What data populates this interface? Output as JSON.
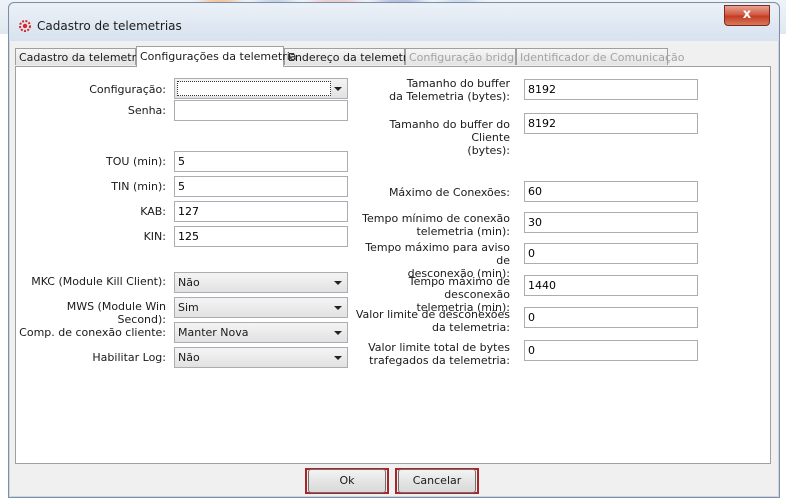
{
  "window": {
    "title": "Cadastro de telemetrias",
    "close_label": "x"
  },
  "tabs": [
    {
      "label": "Cadastro da telemetria",
      "state": "normal"
    },
    {
      "label": "Configurações da telemetria",
      "state": "active"
    },
    {
      "label": "Endereço da telemetria",
      "state": "normal"
    },
    {
      "label": "Configuração bridge",
      "state": "disabled"
    },
    {
      "label": "Identificador de Comunicação",
      "state": "disabled"
    }
  ],
  "left": {
    "configuracao": {
      "label": "Configuração:",
      "value": ""
    },
    "senha": {
      "label": "Senha:",
      "value": ""
    },
    "tou": {
      "label": "TOU (min):",
      "value": "5"
    },
    "tin": {
      "label": "TIN (min):",
      "value": "5"
    },
    "kab": {
      "label": "KAB:",
      "value": "127"
    },
    "kin": {
      "label": "KIN:",
      "value": "125"
    },
    "mkc": {
      "label": "MKC (Module Kill Client):",
      "value": "Não"
    },
    "mws": {
      "label": "MWS (Module Win Second):",
      "value": "Sim"
    },
    "comp": {
      "label": "Comp. de conexão cliente:",
      "value": "Manter Nova"
    },
    "log": {
      "label": "Habilitar Log:",
      "value": "Não"
    }
  },
  "right": {
    "buffer_tel": {
      "label_1": "Tamanho do buffer",
      "label_2": "da Telemetria (bytes):",
      "value": "8192"
    },
    "buffer_cli": {
      "label_1": "Tamanho do buffer do Cliente",
      "label_2": "(bytes):",
      "value": "8192"
    },
    "max_con": {
      "label": "Máximo de Conexões:",
      "value": "60"
    },
    "tmin_con": {
      "label_1": "Tempo mínimo de conexão",
      "label_2": "telemetria (min):",
      "value": "30"
    },
    "tmax_aviso": {
      "label_1": "Tempo máximo para aviso de",
      "label_2": "desconexão (min):",
      "value": "0"
    },
    "tmax_desc": {
      "label_1": "Tempo máximo de desconexão",
      "label_2": "telemetria (min):",
      "value": "1440"
    },
    "lim_desc": {
      "label_1": "Valor limite de desconexões",
      "label_2": "da telemetria:",
      "value": "0"
    },
    "lim_bytes": {
      "label_1": "Valor limite total de bytes",
      "label_2": "trafegados da telemetria:",
      "value": "0"
    }
  },
  "buttons": {
    "ok": "Ok",
    "cancel": "Cancelar"
  },
  "colors": {
    "highlight_frame": "#a8262a",
    "close_button": "#c33a22"
  }
}
